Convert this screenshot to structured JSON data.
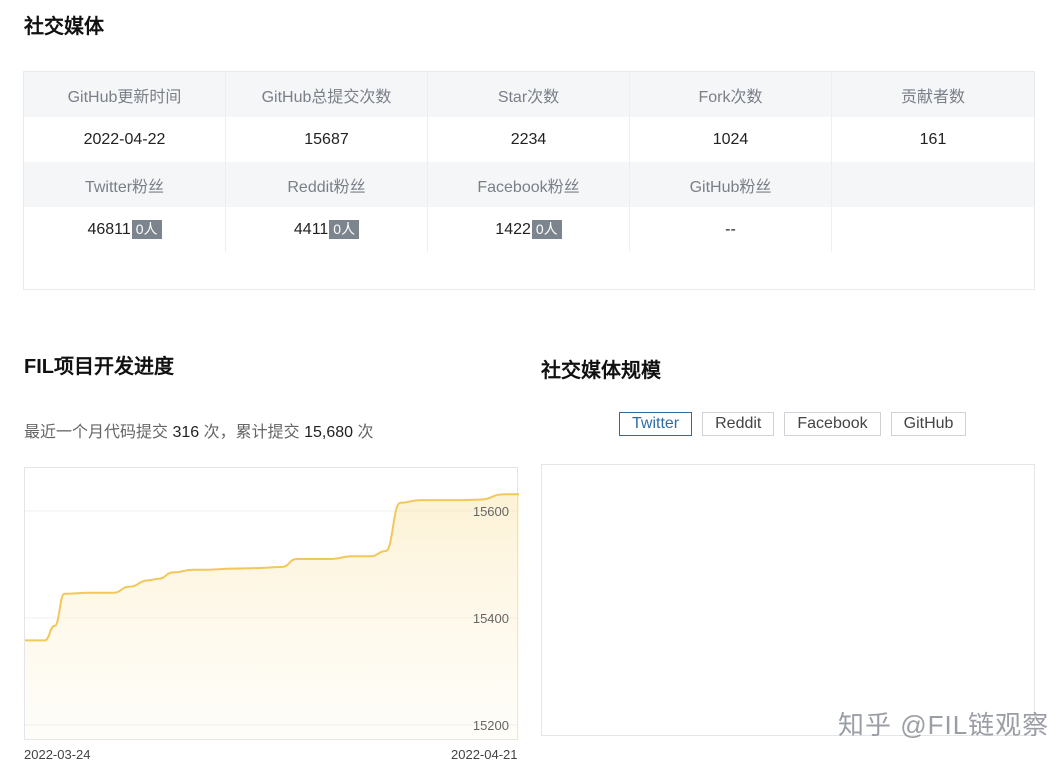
{
  "section_title": "社交媒体",
  "stats": {
    "header1": [
      "GitHub更新时间",
      "GitHub总提交次数",
      "Star次数",
      "Fork次数",
      "贡献者数"
    ],
    "values1": [
      "2022-04-22",
      "15687",
      "2234",
      "1024",
      "161"
    ],
    "header2": [
      "Twitter粉丝",
      "Reddit粉丝",
      "Facebook粉丝",
      "GitHub粉丝",
      ""
    ],
    "values2": [
      {
        "value": "46811",
        "badge": "0人"
      },
      {
        "value": "4411",
        "badge": "0人"
      },
      {
        "value": "1422",
        "badge": "0人"
      },
      {
        "value": "--",
        "badge": ""
      },
      {
        "value": "",
        "badge": ""
      }
    ]
  },
  "dev": {
    "title": "FIL项目开发进度",
    "summary_prefix": "最近一个月代码提交",
    "month_commits": "316",
    "summary_mid": "次，累计提交",
    "total_commits": "15,680",
    "summary_suffix": "次"
  },
  "social": {
    "title": "社交媒体规模",
    "tabs": [
      "Twitter",
      "Reddit",
      "Facebook",
      "GitHub"
    ],
    "active_tab": "Twitter"
  },
  "chart_data": {
    "type": "area",
    "x_labels": [
      "2022-03-24",
      "2022-04-21"
    ],
    "y_ticks": [
      "15600",
      "15400",
      "15200"
    ],
    "ylim": [
      15170,
      15680
    ],
    "line_color": "#f2c75c",
    "x": [
      0,
      0.04,
      0.06,
      0.08,
      0.13,
      0.14,
      0.18,
      0.21,
      0.25,
      0.27,
      0.3,
      0.34,
      0.37,
      0.42,
      0.47,
      0.52,
      0.55,
      0.59,
      0.62,
      0.66,
      0.7,
      0.73,
      0.76,
      0.8,
      0.82,
      0.88,
      0.92,
      0.97,
      1.0
    ],
    "values": [
      15358,
      15358,
      15385,
      15445,
      15447,
      15447,
      15447,
      15458,
      15470,
      15473,
      15485,
      15490,
      15490,
      15492,
      15493,
      15495,
      15510,
      15510,
      15510,
      15515,
      15515,
      15525,
      15615,
      15620,
      15620,
      15620,
      15621,
      15631,
      15631
    ]
  },
  "watermark": "知乎 @FIL链观察"
}
